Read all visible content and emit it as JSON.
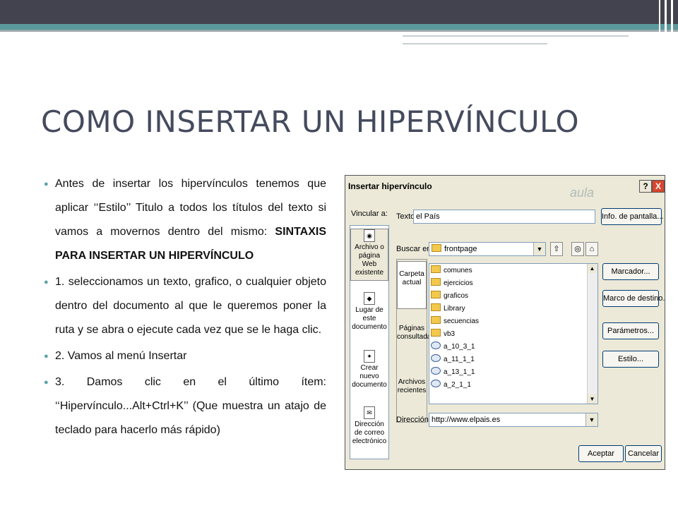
{
  "slide": {
    "title": "COMO INSERTAR UN HIPERVÍNCULO",
    "bullets": [
      {
        "text": "Antes de insertar los hipervínculos tenemos que aplicar ‘‘Estilo’’ Titulo a todos los títulos del texto si vamos a movernos dentro del mismo: ",
        "bold": "SINTAXIS PARA INSERTAR UN HIPERVÍNCULO"
      },
      {
        "text": "1. seleccionamos un texto, grafico, o cualquier objeto dentro del documento al que le queremos poner la ruta y se abra o ejecute cada vez que se le haga clic.",
        "bold": ""
      },
      {
        "text": "2. Vamos al menú Insertar",
        "bold": ""
      },
      {
        "text": "3. Damos clic en el último ítem: ‘‘Hipervínculo...Alt+Ctrl+K’’ (Que muestra un atajo de teclado para hacerlo más rápido)",
        "bold": ""
      }
    ],
    "colors": {
      "title": "#454b5e",
      "bullet": "#5aa3a6",
      "header_dark": "#43434f",
      "header_teal": "#5a9a9c"
    }
  },
  "dialog": {
    "title": "Insertar hipervínculo",
    "help_label": "?",
    "close_label": "X",
    "watermark": "aula",
    "link_to_label": "Vincular a:",
    "text_label": "Texto:",
    "text_value": "el País",
    "screentip_button": "Info. de pantalla...",
    "look_in_label": "Buscar en:",
    "look_in_value": "frontpage",
    "link_options": [
      {
        "label": "Archivo o página Web existente",
        "icon": "web-page-icon"
      },
      {
        "label": "Lugar de este documento",
        "icon": "document-place-icon"
      },
      {
        "label": "Crear nuevo documento",
        "icon": "new-document-icon"
      },
      {
        "label": "Dirección de correo electrónico",
        "icon": "email-icon"
      }
    ],
    "left_tabs": [
      "Carpeta actual",
      "Páginas consultadas",
      "Archivos recientes"
    ],
    "files": [
      {
        "name": "comunes",
        "type": "folder"
      },
      {
        "name": "ejercicios",
        "type": "folder"
      },
      {
        "name": "graficos",
        "type": "folder"
      },
      {
        "name": "Library",
        "type": "folder"
      },
      {
        "name": "secuencias",
        "type": "folder"
      },
      {
        "name": "vb3",
        "type": "folder"
      },
      {
        "name": "a_10_3_1",
        "type": "web"
      },
      {
        "name": "a_11_1_1",
        "type": "web"
      },
      {
        "name": "a_13_1_1",
        "type": "web"
      },
      {
        "name": "a_2_1_1",
        "type": "web"
      }
    ],
    "side_buttons": [
      "Marcador...",
      "Marco de destino...",
      "Parámetros...",
      "Estilo..."
    ],
    "address_label": "Dirección:",
    "address_value": "http://www.elpais.es",
    "ok_label": "Aceptar",
    "cancel_label": "Cancelar"
  }
}
